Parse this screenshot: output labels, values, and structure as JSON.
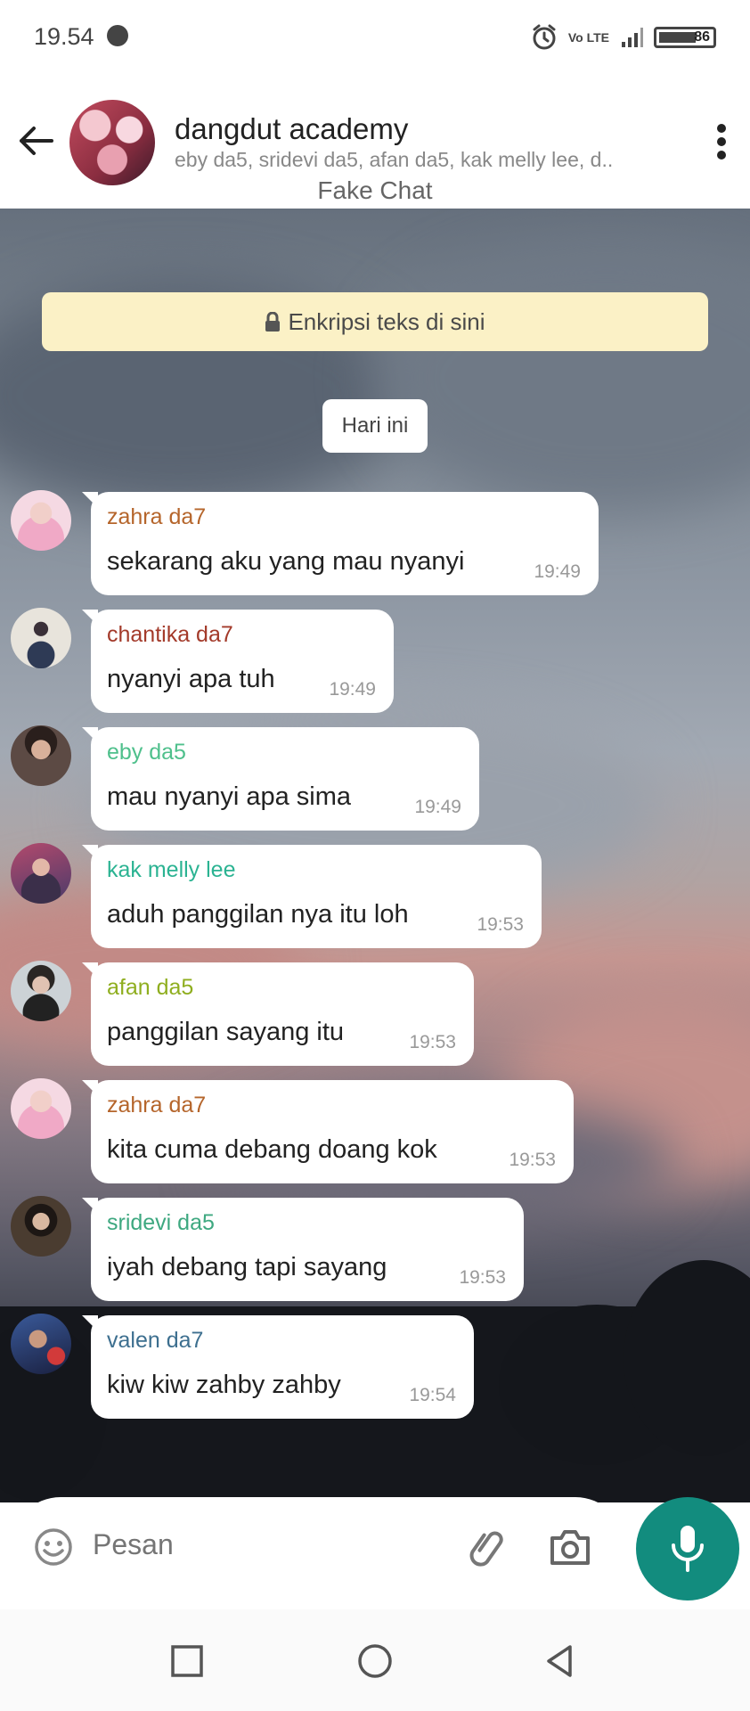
{
  "status_bar": {
    "time": "19.54",
    "network": "Vo LTE",
    "battery": "86"
  },
  "header": {
    "group_name": "dangdut academy",
    "members": "eby da5, sridevi da5, afan da5, kak melly lee, d..",
    "subtitle": "Fake Chat"
  },
  "chat": {
    "encryption_notice": "Enkripsi teks di sini",
    "date_label": "Hari ini",
    "messages": [
      {
        "sender": "zahra da7",
        "sender_color": "#b5652b",
        "text": "sekarang aku yang mau nyanyi",
        "time": "19:49"
      },
      {
        "sender": "chantika da7",
        "sender_color": "#a33a2a",
        "text": "nyanyi apa tuh",
        "time": "19:49"
      },
      {
        "sender": "eby da5",
        "sender_color": "#4fc08c",
        "text": "mau nyanyi apa sima",
        "time": "19:49"
      },
      {
        "sender": "kak melly lee",
        "sender_color": "#2bb392",
        "text": "aduh panggilan nya itu loh",
        "time": "19:53"
      },
      {
        "sender": "afan da5",
        "sender_color": "#8fae1f",
        "text": "panggilan sayang itu",
        "time": "19:53"
      },
      {
        "sender": "zahra da7",
        "sender_color": "#b5652b",
        "text": "kita cuma debang doang kok",
        "time": "19:53"
      },
      {
        "sender": "sridevi da5",
        "sender_color": "#3ea880",
        "text": "iyah debang tapi sayang",
        "time": "19:53"
      },
      {
        "sender": "valen da7",
        "sender_color": "#3d6f8f",
        "text": "kiw kiw zahby zahby",
        "time": "19:54"
      }
    ]
  },
  "compose": {
    "placeholder": "Pesan"
  },
  "icons": {
    "back": "arrow-left",
    "menu": "more-vertical",
    "lock": "lock",
    "emoji": "smiley",
    "attach": "paperclip",
    "camera": "camera",
    "mic": "microphone",
    "nav": [
      "square",
      "circle",
      "triangle-left"
    ]
  },
  "colors": {
    "accent": "#128c7e",
    "banner": "#fbf1c6",
    "bubble": "#ffffff"
  }
}
